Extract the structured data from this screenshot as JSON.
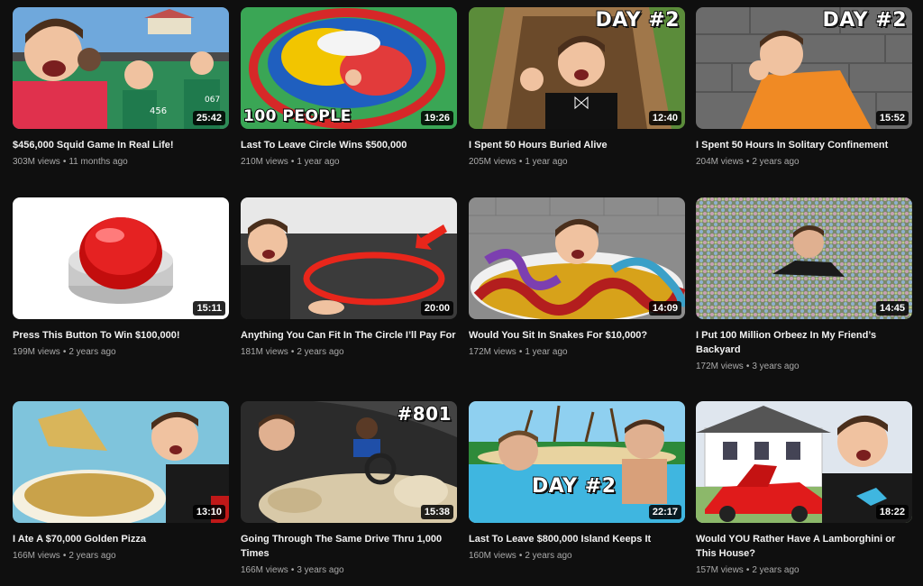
{
  "videos": [
    {
      "title": "$456,000 Squid Game In Real Life!",
      "views": "303M views",
      "age": "11 months ago",
      "duration": "25:42",
      "overlay": "",
      "colors": [
        "#6fa8dc",
        "#2e8b57"
      ]
    },
    {
      "title": "Last To Leave Circle Wins $500,000",
      "views": "210M views",
      "age": "1 year ago",
      "duration": "19:26",
      "overlay": "100 PEOPLE",
      "colors": [
        "#3aa655",
        "#d62828"
      ]
    },
    {
      "title": "I Spent 50 Hours Buried Alive",
      "views": "205M views",
      "age": "1 year ago",
      "duration": "12:40",
      "overlay": "DAY #2",
      "colors": [
        "#5b8c3a",
        "#a0774a"
      ]
    },
    {
      "title": "I Spent 50 Hours In Solitary Confinement",
      "views": "204M views",
      "age": "2 years ago",
      "duration": "15:52",
      "overlay": "DAY #2",
      "colors": [
        "#6b6b6b",
        "#f08a24"
      ]
    },
    {
      "title": "Press This Button To Win $100,000!",
      "views": "199M views",
      "age": "2 years ago",
      "duration": "15:11",
      "overlay": "",
      "colors": [
        "#ffffff",
        "#d90f0f"
      ]
    },
    {
      "title": "Anything You Can Fit In The Circle I’ll Pay For",
      "views": "181M views",
      "age": "2 years ago",
      "duration": "20:00",
      "overlay": "",
      "colors": [
        "#3b3b3b",
        "#e8261b"
      ]
    },
    {
      "title": "Would You Sit In Snakes For $10,000?",
      "views": "172M views",
      "age": "1 year ago",
      "duration": "14:09",
      "overlay": "",
      "colors": [
        "#8c8c8c",
        "#d7a21a"
      ]
    },
    {
      "title": "I Put 100 Million Orbeez In My Friend’s Backyard",
      "views": "172M views",
      "age": "3 years ago",
      "duration": "14:45",
      "overlay": "",
      "colors": [
        "#7a8a6a",
        "#b68f7a"
      ]
    },
    {
      "title": "I Ate A $70,000 Golden Pizza",
      "views": "166M views",
      "age": "2 years ago",
      "duration": "13:10",
      "overlay": "",
      "colors": [
        "#7fc4dc",
        "#c9a24a"
      ]
    },
    {
      "title": "Going Through The Same Drive Thru 1,000 Times",
      "views": "166M views",
      "age": "3 years ago",
      "duration": "15:38",
      "overlay": "#801",
      "colors": [
        "#2b2b2b",
        "#d8c9a8"
      ]
    },
    {
      "title": "Last To Leave $800,000 Island Keeps It",
      "views": "160M views",
      "age": "2 years ago",
      "duration": "22:17",
      "overlay": "DAY #2",
      "colors": [
        "#3fb6e0",
        "#e8d3a0"
      ]
    },
    {
      "title": "Would YOU Rather Have A Lamborghini or This House?",
      "views": "157M views",
      "age": "2 years ago",
      "duration": "18:22",
      "overlay": "",
      "colors": [
        "#dfe6ee",
        "#e01b1b"
      ]
    }
  ]
}
